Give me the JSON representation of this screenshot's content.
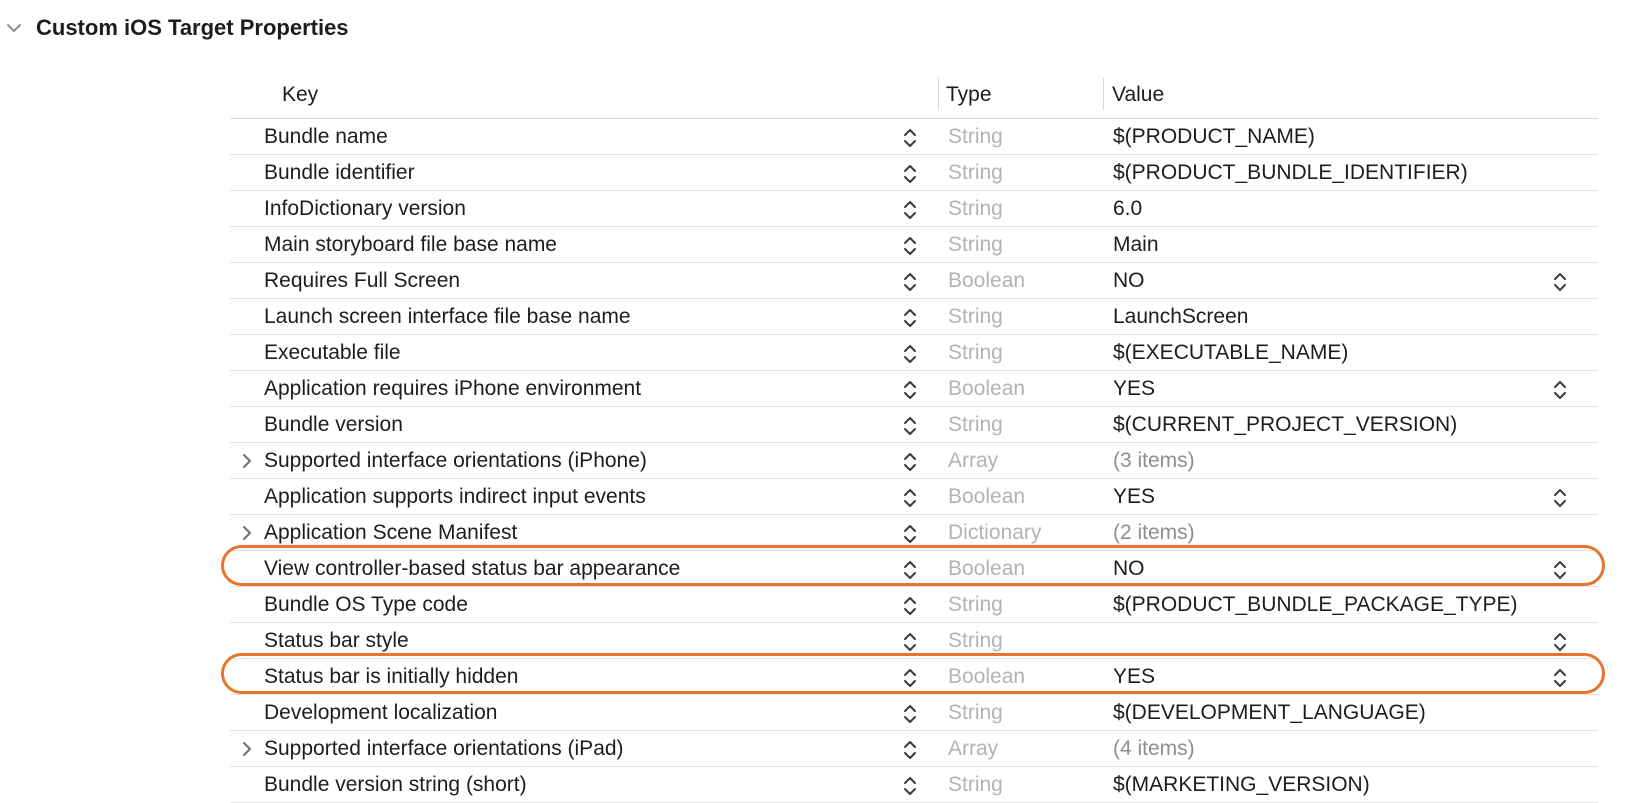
{
  "section": {
    "title": "Custom iOS Target Properties",
    "icon": "chevron-down-icon"
  },
  "table": {
    "headers": {
      "key": "Key",
      "type": "Type",
      "value": "Value"
    },
    "rows": [
      {
        "key": "Bundle name",
        "type": "String",
        "value": "$(PRODUCT_NAME)",
        "expandable": false,
        "value_stepper": false,
        "muted": false,
        "highlighted": false
      },
      {
        "key": "Bundle identifier",
        "type": "String",
        "value": "$(PRODUCT_BUNDLE_IDENTIFIER)",
        "expandable": false,
        "value_stepper": false,
        "muted": false,
        "highlighted": false
      },
      {
        "key": "InfoDictionary version",
        "type": "String",
        "value": "6.0",
        "expandable": false,
        "value_stepper": false,
        "muted": false,
        "highlighted": false
      },
      {
        "key": "Main storyboard file base name",
        "type": "String",
        "value": "Main",
        "expandable": false,
        "value_stepper": false,
        "muted": false,
        "highlighted": false
      },
      {
        "key": "Requires Full Screen",
        "type": "Boolean",
        "value": "NO",
        "expandable": false,
        "value_stepper": true,
        "muted": false,
        "highlighted": false
      },
      {
        "key": "Launch screen interface file base name",
        "type": "String",
        "value": "LaunchScreen",
        "expandable": false,
        "value_stepper": false,
        "muted": false,
        "highlighted": false
      },
      {
        "key": "Executable file",
        "type": "String",
        "value": "$(EXECUTABLE_NAME)",
        "expandable": false,
        "value_stepper": false,
        "muted": false,
        "highlighted": false
      },
      {
        "key": "Application requires iPhone environment",
        "type": "Boolean",
        "value": "YES",
        "expandable": false,
        "value_stepper": true,
        "muted": false,
        "highlighted": false
      },
      {
        "key": "Bundle version",
        "type": "String",
        "value": "$(CURRENT_PROJECT_VERSION)",
        "expandable": false,
        "value_stepper": false,
        "muted": false,
        "highlighted": false
      },
      {
        "key": "Supported interface orientations (iPhone)",
        "type": "Array",
        "value": "(3 items)",
        "expandable": true,
        "value_stepper": false,
        "muted": true,
        "highlighted": false
      },
      {
        "key": "Application supports indirect input events",
        "type": "Boolean",
        "value": "YES",
        "expandable": false,
        "value_stepper": true,
        "muted": false,
        "highlighted": false
      },
      {
        "key": "Application Scene Manifest",
        "type": "Dictionary",
        "value": "(2 items)",
        "expandable": true,
        "value_stepper": false,
        "muted": true,
        "highlighted": false
      },
      {
        "key": "View controller-based status bar appearance",
        "type": "Boolean",
        "value": "NO",
        "expandable": false,
        "value_stepper": true,
        "muted": false,
        "highlighted": true
      },
      {
        "key": "Bundle OS Type code",
        "type": "String",
        "value": "$(PRODUCT_BUNDLE_PACKAGE_TYPE)",
        "expandable": false,
        "value_stepper": false,
        "muted": false,
        "highlighted": false
      },
      {
        "key": "Status bar style",
        "type": "String",
        "value": "",
        "expandable": false,
        "value_stepper": true,
        "muted": false,
        "highlighted": false
      },
      {
        "key": "Status bar is initially hidden",
        "type": "Boolean",
        "value": "YES",
        "expandable": false,
        "value_stepper": true,
        "muted": false,
        "highlighted": true
      },
      {
        "key": "Development localization",
        "type": "String",
        "value": "$(DEVELOPMENT_LANGUAGE)",
        "expandable": false,
        "value_stepper": false,
        "muted": false,
        "highlighted": false
      },
      {
        "key": "Supported interface orientations (iPad)",
        "type": "Array",
        "value": "(4 items)",
        "expandable": true,
        "value_stepper": false,
        "muted": true,
        "highlighted": false
      },
      {
        "key": "Bundle version string (short)",
        "type": "String",
        "value": "$(MARKETING_VERSION)",
        "expandable": false,
        "value_stepper": false,
        "muted": false,
        "highlighted": false
      }
    ]
  },
  "colors": {
    "highlight": "#e8742e",
    "type_text": "#b3b3b3",
    "muted_value": "#8e8e93"
  },
  "icons": {
    "row_expander": "chevron-right-icon",
    "stepper": "up-down-chevron-icon"
  }
}
